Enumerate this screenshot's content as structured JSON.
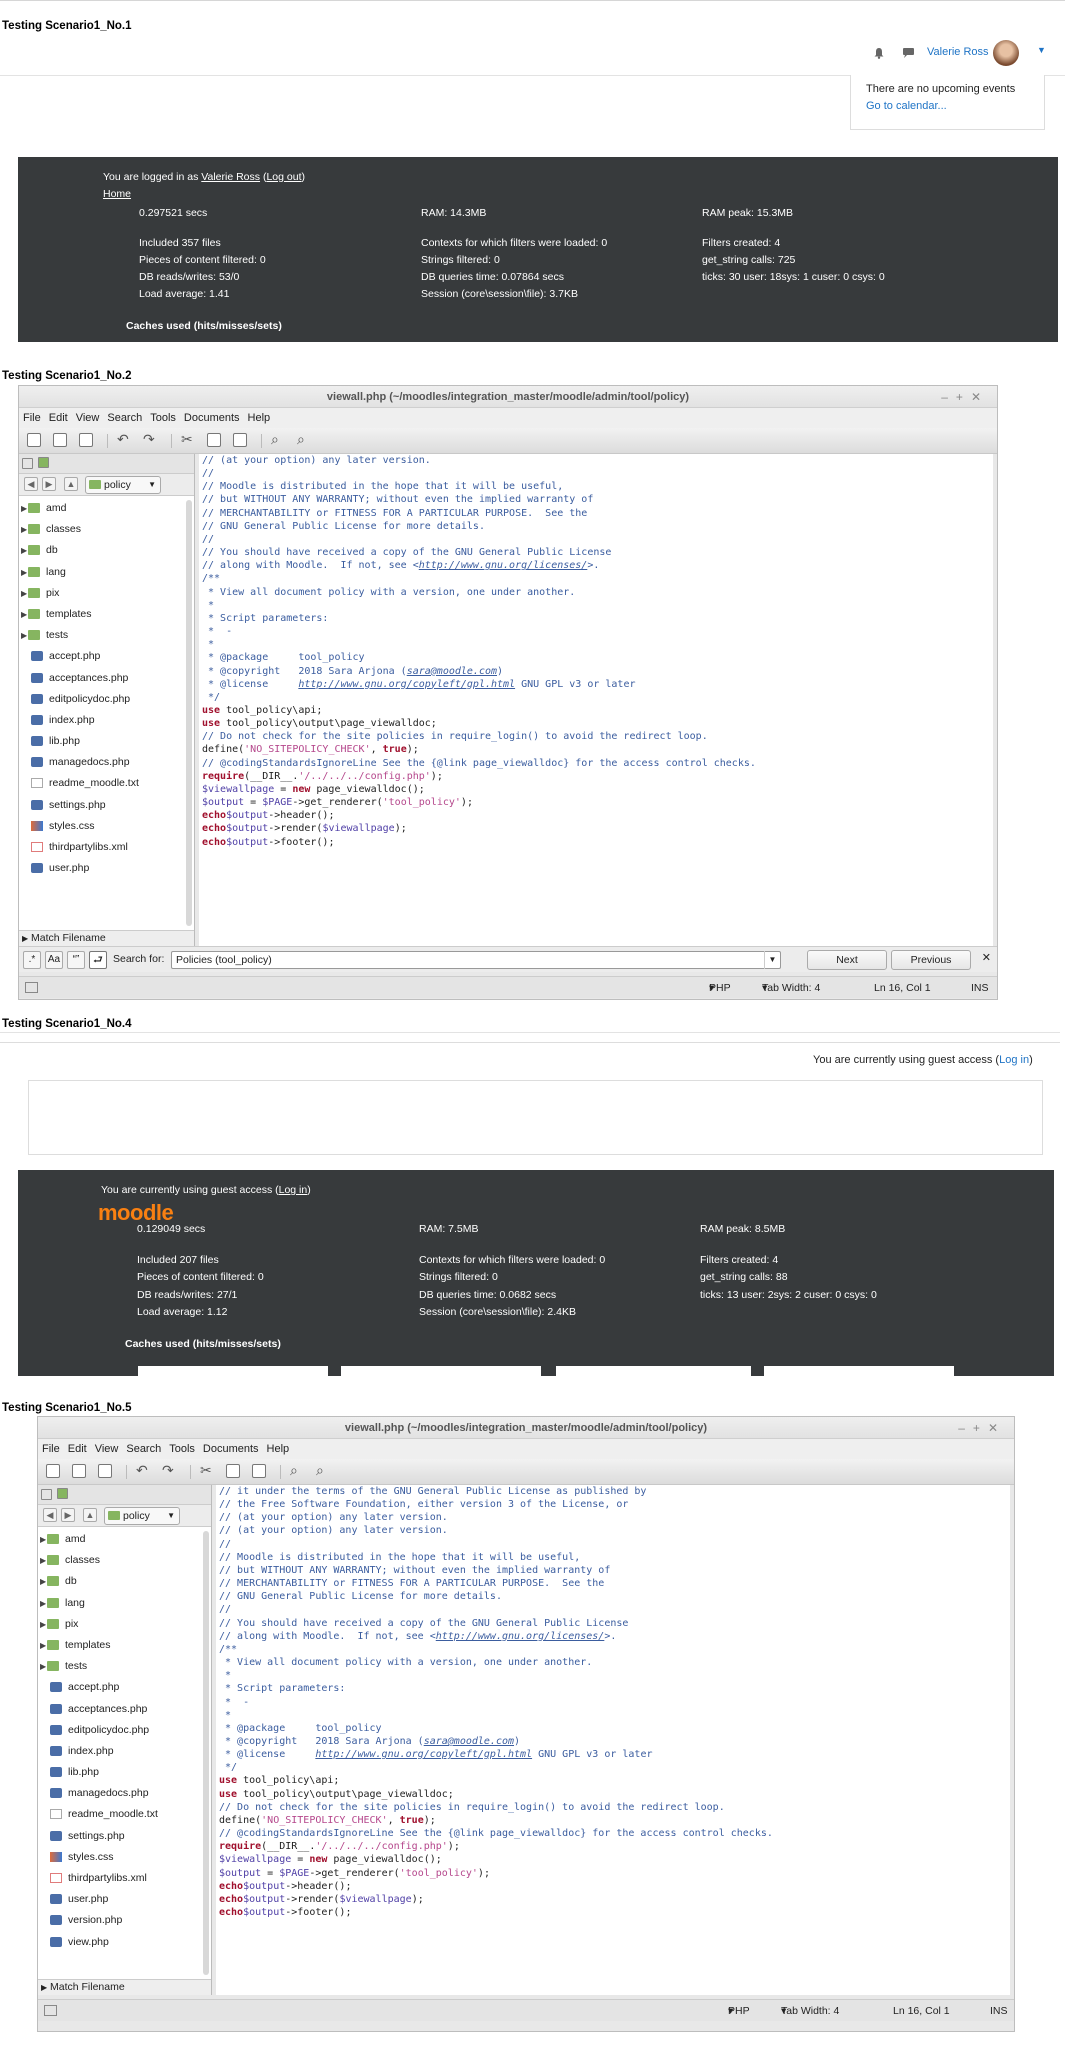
{
  "s1": {
    "title": "Testing Scenario1_No.1",
    "user_name": "Valerie Ross",
    "no_events": "There are no upcoming events",
    "go_calendar": "Go to calendar...",
    "logged_in_prefix": "You are logged in as ",
    "logged_user": "Valerie Ross",
    "logout": "Log out",
    "home": "Home",
    "stats": {
      "secs": "0.297521 secs",
      "ram": "RAM: 14.3MB",
      "ram_peak": "RAM peak: 15.3MB",
      "included": "Included 357 files",
      "contexts": "Contexts for which filters were loaded: 0",
      "filters": "Filters created: 4",
      "pieces": "Pieces of content filtered: 0",
      "strings": "Strings filtered: 0",
      "get_string": "get_string calls: 725",
      "dbrw": "DB reads/writes: 53/0",
      "dbq": "DB queries time: 0.07864 secs",
      "ticks": "ticks: 30 user: 18sys: 1 cuser: 0 csys: 0",
      "load": "Load average: 1.41",
      "session": "Session (core\\session\\file): 3.7KB"
    },
    "caches": "Caches used (hits/misses/sets)"
  },
  "s2": {
    "title": "Testing Scenario1_No.2",
    "window_title": "viewall.php (~/moodles/integration_master/moodle/admin/tool/policy)",
    "menu": [
      "File",
      "Edit",
      "View",
      "Search",
      "Tools",
      "Documents",
      "Help"
    ],
    "path": "policy",
    "files": [
      {
        "name": "amd",
        "type": "folder"
      },
      {
        "name": "classes",
        "type": "folder"
      },
      {
        "name": "db",
        "type": "folder"
      },
      {
        "name": "lang",
        "type": "folder"
      },
      {
        "name": "pix",
        "type": "folder"
      },
      {
        "name": "templates",
        "type": "folder"
      },
      {
        "name": "tests",
        "type": "folder"
      },
      {
        "name": "accept.php",
        "type": "php"
      },
      {
        "name": "acceptances.php",
        "type": "php"
      },
      {
        "name": "editpolicydoc.php",
        "type": "php"
      },
      {
        "name": "index.php",
        "type": "php"
      },
      {
        "name": "lib.php",
        "type": "php"
      },
      {
        "name": "managedocs.php",
        "type": "php"
      },
      {
        "name": "readme_moodle.txt",
        "type": "txt"
      },
      {
        "name": "settings.php",
        "type": "php"
      },
      {
        "name": "styles.css",
        "type": "css"
      },
      {
        "name": "thirdpartylibs.xml",
        "type": "xml"
      },
      {
        "name": "user.php",
        "type": "php"
      }
    ],
    "match_filename": "Match Filename",
    "search_label": "Search for:",
    "search_value": "Policies (tool_policy)",
    "btn_aa": "Aa",
    "btn_quotes": "“”",
    "btn_dotstar": ".*",
    "next": "Next",
    "previous": "Previous",
    "lang": "PHP",
    "tab_width": "Tab Width: 4",
    "position": "Ln 16, Col 1",
    "mode": "INS",
    "code_lines": [
      [
        [
          "c",
          "// (at your option) any later version."
        ]
      ],
      [
        [
          "c",
          "//"
        ]
      ],
      [
        [
          "c",
          "// Moodle is distributed in the hope that it will be useful,"
        ]
      ],
      [
        [
          "c",
          "// but WITHOUT ANY WARRANTY; without even the implied warranty of"
        ]
      ],
      [
        [
          "c",
          "// MERCHANTABILITY or FITNESS FOR A PARTICULAR PURPOSE.  See the"
        ]
      ],
      [
        [
          "c",
          "// GNU General Public License for more details."
        ]
      ],
      [
        [
          "c",
          "//"
        ]
      ],
      [
        [
          "c",
          "// You should have received a copy of the GNU General Public License"
        ]
      ],
      [
        [
          "c",
          "// along with Moodle.  If not, see <"
        ],
        [
          "c lnk",
          "http://www.gnu.org/licenses/"
        ],
        [
          "c",
          ">."
        ]
      ],
      [
        [
          "",
          ""
        ]
      ],
      [
        [
          "c",
          "/**"
        ]
      ],
      [
        [
          "c",
          " * View all document policy with a version, one under another."
        ]
      ],
      [
        [
          "c",
          " *"
        ]
      ],
      [
        [
          "c",
          " * Script parameters:"
        ]
      ],
      [
        [
          "c",
          " *  -"
        ]
      ],
      [
        [
          "c",
          " *"
        ]
      ],
      [
        [
          "c",
          " * @package     tool_policy"
        ]
      ],
      [
        [
          "c",
          " * @copyright   2018 Sara Arjona ("
        ],
        [
          "c lnk",
          "sara@moodle.com"
        ],
        [
          "c",
          ")"
        ]
      ],
      [
        [
          "c",
          " * @license     "
        ],
        [
          "c lnk",
          "http://www.gnu.org/copyleft/gpl.html"
        ],
        [
          "c",
          " GNU GPL v3 or later"
        ]
      ],
      [
        [
          "c",
          " */"
        ]
      ],
      [
        [
          "",
          ""
        ]
      ],
      [
        [
          "kw",
          "use"
        ],
        [
          "",
          " tool_policy\\api;"
        ]
      ],
      [
        [
          "kw",
          "use"
        ],
        [
          "",
          " tool_policy\\output\\page_viewalldoc;"
        ]
      ],
      [
        [
          "",
          ""
        ]
      ],
      [
        [
          "c",
          "// Do not check for the site policies in require_login() to avoid the redirect loop."
        ]
      ],
      [
        [
          "",
          "define("
        ],
        [
          "str",
          "'NO_SITEPOLICY_CHECK'"
        ],
        [
          "",
          ", "
        ],
        [
          "kw",
          "true"
        ],
        [
          "",
          ");"
        ]
      ],
      [
        [
          "",
          ""
        ]
      ],
      [
        [
          "c",
          "// @codingStandardsIgnoreLine See the {@link page_viewalldoc} for the access control checks."
        ]
      ],
      [
        [
          "kw",
          "require"
        ],
        [
          "",
          "(__DIR__."
        ],
        [
          "str",
          "'/../../../config.php'"
        ],
        [
          "",
          ");"
        ]
      ],
      [
        [
          "",
          ""
        ]
      ],
      [
        [
          "var",
          "$viewallpage"
        ],
        [
          "",
          " = "
        ],
        [
          "kw",
          "new"
        ],
        [
          "",
          " page_viewalldoc();"
        ]
      ],
      [
        [
          "",
          ""
        ]
      ],
      [
        [
          "var",
          "$output"
        ],
        [
          "",
          " = "
        ],
        [
          "var",
          "$PAGE"
        ],
        [
          "",
          "->get_renderer("
        ],
        [
          "str",
          "'tool_policy'"
        ],
        [
          "",
          ");"
        ]
      ],
      [
        [
          "",
          ""
        ]
      ],
      [
        [
          "kw",
          "echo"
        ],
        [
          " ",
          ""
        ],
        [
          "var",
          "$output"
        ],
        [
          "",
          "->header();"
        ]
      ],
      [
        [
          "kw",
          "echo"
        ],
        [
          " ",
          ""
        ],
        [
          "var",
          "$output"
        ],
        [
          "",
          "->render("
        ],
        [
          "var",
          "$viewallpage"
        ],
        [
          "",
          ");"
        ]
      ],
      [
        [
          "kw",
          "echo"
        ],
        [
          " ",
          ""
        ],
        [
          "var",
          "$output"
        ],
        [
          "",
          "->footer();"
        ]
      ]
    ]
  },
  "s4": {
    "title": "Testing Scenario1_No.4",
    "guest_text": "You are currently using guest access (",
    "login": "Log in",
    "close_paren": ")",
    "logo": "moodle",
    "stats": {
      "secs": "0.129049 secs",
      "ram": "RAM: 7.5MB",
      "ram_peak": "RAM peak: 8.5MB",
      "included": "Included 207 files",
      "contexts": "Contexts for which filters were loaded: 0",
      "filters": "Filters created: 4",
      "pieces": "Pieces of content filtered: 0",
      "strings": "Strings filtered: 0",
      "get_string": "get_string calls: 88",
      "dbrw": "DB reads/writes: 27/1",
      "dbq": "DB queries time: 0.0682 secs",
      "ticks": "ticks: 13 user: 2sys: 2 cuser: 0 csys: 0",
      "load": "Load average: 1.12",
      "session": "Session (core\\session\\file): 2.4KB"
    },
    "caches": "Caches used (hits/misses/sets)"
  },
  "s5": {
    "title": "Testing Scenario1_No.5",
    "extra_files": [
      {
        "name": "version.php",
        "type": "php"
      },
      {
        "name": "view.php",
        "type": "php"
      }
    ],
    "code_top": [
      [
        [
          "c",
          "// it under the terms of the GNU General Public License as published by"
        ]
      ],
      [
        [
          "c",
          "// the Free Software Foundation, either version 3 of the License, or"
        ]
      ],
      [
        [
          "c",
          "// (at your option) any later version."
        ]
      ]
    ]
  }
}
